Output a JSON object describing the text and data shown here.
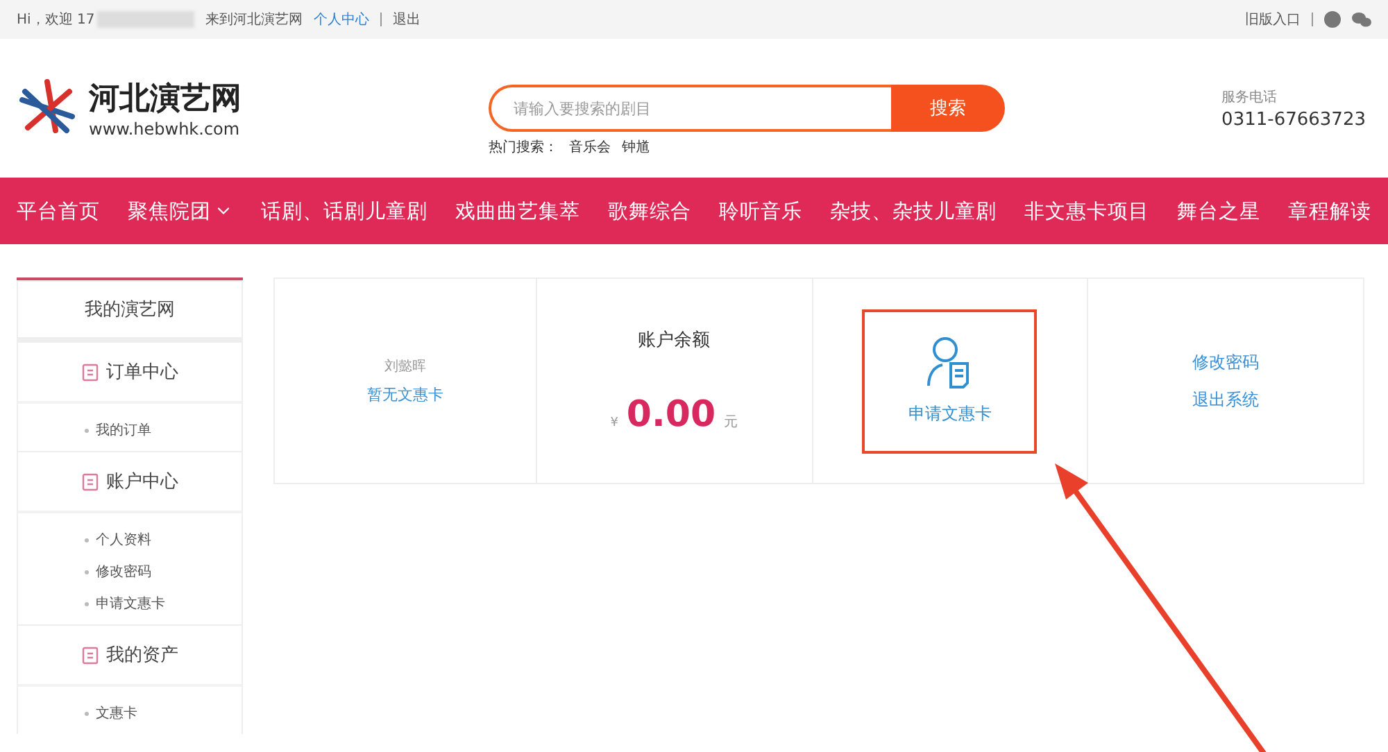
{
  "top_bar": {
    "greeting": "Hi，欢迎 17",
    "welcome_suffix": "来到河北演艺网",
    "links": [
      {
        "label": "个人中心",
        "kind": "link"
      },
      {
        "label": "退出",
        "kind": "plain"
      }
    ],
    "right_link": "旧版入口"
  },
  "header": {
    "logo_title": "河北演艺网",
    "logo_url": "www.hebwhk.com",
    "search": {
      "placeholder": "请输入要搜索的剧目",
      "button": "搜索",
      "hot_label": "热门搜索：",
      "hot_terms": [
        "音乐会",
        "钟馗"
      ]
    },
    "phone_label": "服务电话",
    "phone": "0311-67663723"
  },
  "nav": [
    {
      "label": "平台首页",
      "dropdown": false
    },
    {
      "label": "聚焦院团",
      "dropdown": true
    },
    {
      "label": "话剧、话剧儿童剧",
      "dropdown": false
    },
    {
      "label": "戏曲曲艺集萃",
      "dropdown": false
    },
    {
      "label": "歌舞综合",
      "dropdown": false
    },
    {
      "label": "聆听音乐",
      "dropdown": false
    },
    {
      "label": "杂技、杂技儿童剧",
      "dropdown": false
    },
    {
      "label": "非文惠卡项目",
      "dropdown": false
    },
    {
      "label": "舞台之星",
      "dropdown": false
    },
    {
      "label": "章程解读",
      "dropdown": false
    }
  ],
  "sidebar": {
    "title": "我的演艺网",
    "sections": [
      {
        "title": "订单中心",
        "items": [
          "我的订单"
        ]
      },
      {
        "title": "账户中心",
        "items": [
          "个人资料",
          "修改密码",
          "申请文惠卡"
        ]
      },
      {
        "title": "我的资产",
        "items": [
          "文惠卡"
        ]
      }
    ]
  },
  "cards": [
    {
      "kind": "user",
      "name": "刘懿晖",
      "link": "暂无文惠卡"
    },
    {
      "kind": "balance",
      "title": "账户余额",
      "currency": "¥",
      "amount": "0.00",
      "unit": "元"
    },
    {
      "kind": "action",
      "label": "申请文惠卡",
      "highlighted": true
    },
    {
      "kind": "links",
      "links": [
        "修改密码",
        "退出系统"
      ]
    }
  ],
  "annotation": {
    "arrow": true
  }
}
